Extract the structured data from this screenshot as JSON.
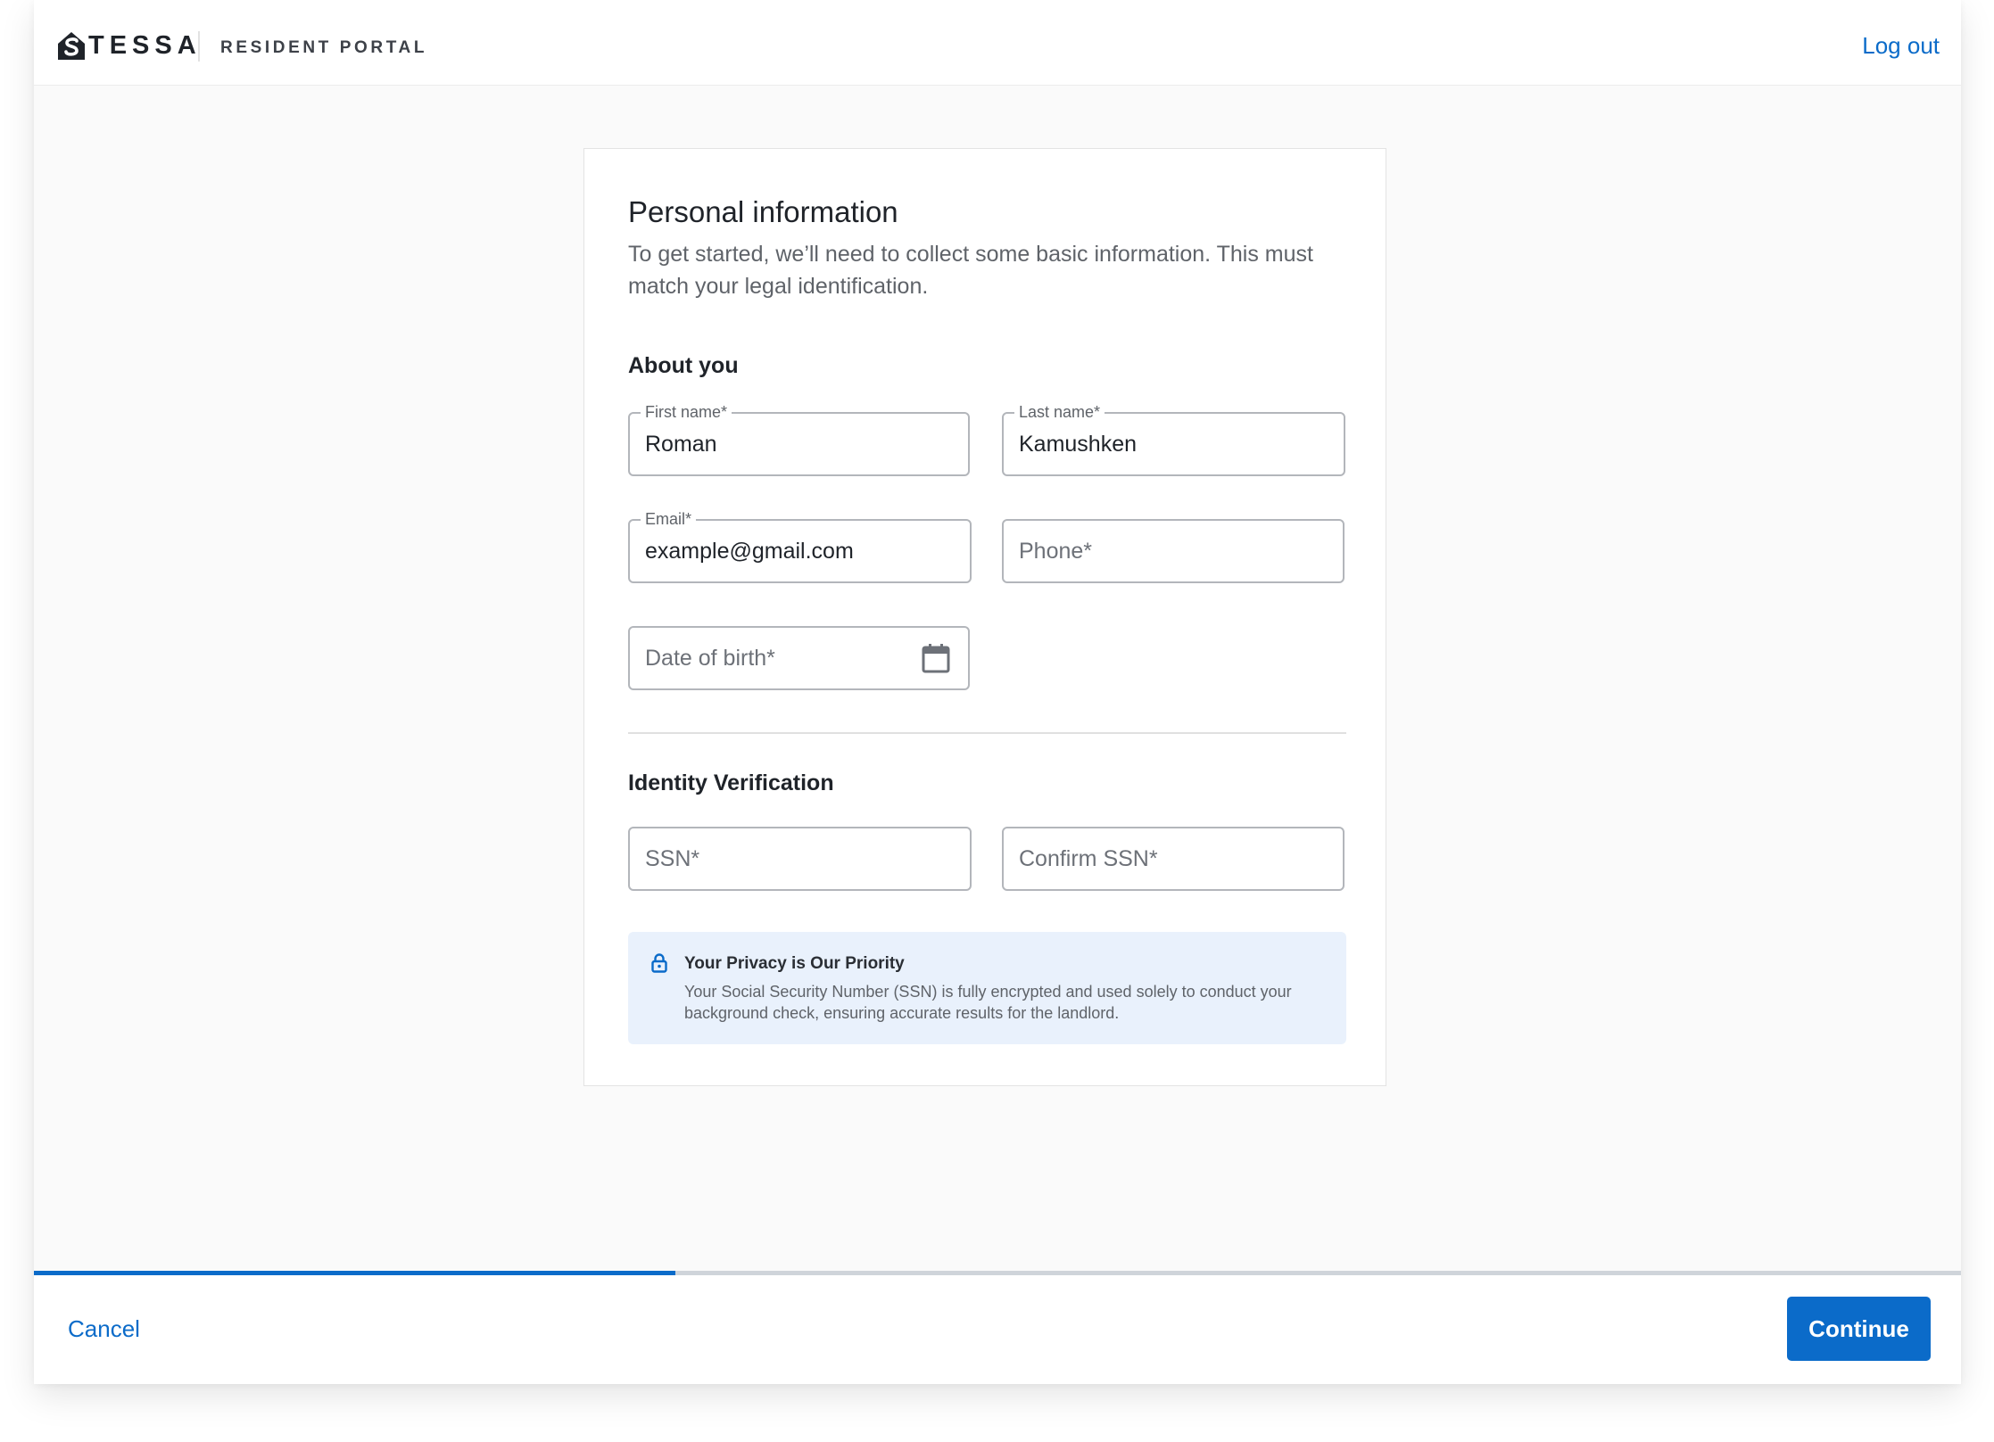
{
  "header": {
    "brand": "TESSA",
    "portal": "RESIDENT PORTAL",
    "logout": "Log out"
  },
  "form": {
    "title": "Personal information",
    "description": "To get started, we’ll need to collect some basic information. This must match your legal identification.",
    "about": {
      "title": "About you",
      "first_name": {
        "label": "First name*",
        "value": "Roman"
      },
      "last_name": {
        "label": "Last name*",
        "value": "Kamushken"
      },
      "email": {
        "label": "Email*",
        "value": "example@gmail.com"
      },
      "phone": {
        "placeholder": "Phone*"
      },
      "dob": {
        "placeholder": "Date of birth*",
        "icon": "calendar-icon"
      }
    },
    "identity": {
      "title": "Identity Verification",
      "ssn": {
        "placeholder": "SSN*"
      },
      "confirm_ssn": {
        "placeholder": "Confirm SSN*"
      }
    },
    "privacy": {
      "icon": "lock-icon",
      "title": "Your Privacy is Our Priority",
      "body": "Your Social Security Number (SSN) is fully encrypted and used solely to conduct your background check, ensuring accurate results for the landlord."
    }
  },
  "progress": {
    "percent": 33.3
  },
  "footer": {
    "cancel": "Cancel",
    "continue": "Continue"
  },
  "colors": {
    "accent": "#0b6bc9",
    "notice_bg": "#e9f1fc",
    "progress_track": "#cfd4da"
  }
}
